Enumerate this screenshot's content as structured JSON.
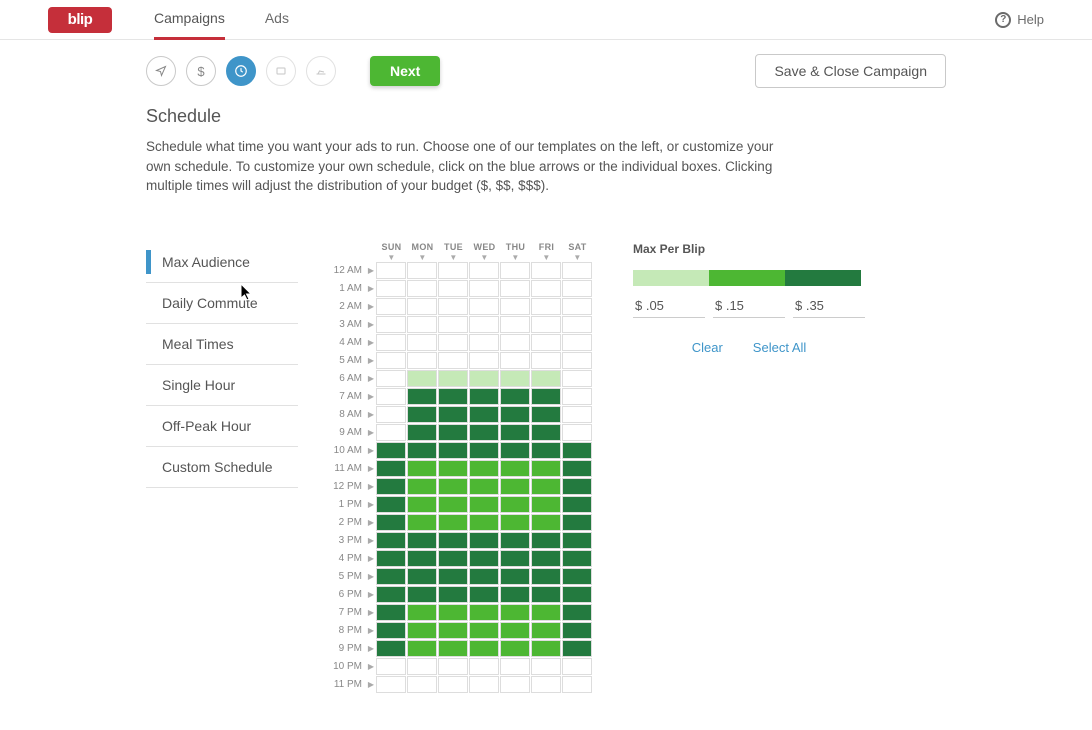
{
  "nav": {
    "brand": "blip",
    "tabs": [
      "Campaigns",
      "Ads"
    ],
    "active": 0,
    "help": "Help"
  },
  "stepper": {
    "next": "Next",
    "save": "Save & Close Campaign"
  },
  "header": {
    "title": "Schedule",
    "body": "Schedule what time you want your ads to run. Choose one of our templates on the left, or customize your own schedule. To customize your own schedule, click on the blue arrows or the individual boxes. Clicking multiple times will adjust the distribution of your budget ($, $$, $$$)."
  },
  "templates": {
    "items": [
      "Max Audience",
      "Daily Commute",
      "Meal Times",
      "Single Hour",
      "Off-Peak Hour",
      "Custom Schedule"
    ],
    "active": 0
  },
  "schedule": {
    "days": [
      "SUN",
      "MON",
      "TUE",
      "WED",
      "THU",
      "FRI",
      "SAT"
    ],
    "hours": [
      "12 AM",
      "1 AM",
      "2 AM",
      "3 AM",
      "4 AM",
      "5 AM",
      "6 AM",
      "7 AM",
      "8 AM",
      "9 AM",
      "10 AM",
      "11 AM",
      "12 PM",
      "1 PM",
      "2 PM",
      "3 PM",
      "4 PM",
      "5 PM",
      "6 PM",
      "7 PM",
      "8 PM",
      "9 PM",
      "10 PM",
      "11 PM"
    ],
    "grid": [
      [
        0,
        0,
        0,
        0,
        0,
        0,
        0
      ],
      [
        0,
        0,
        0,
        0,
        0,
        0,
        0
      ],
      [
        0,
        0,
        0,
        0,
        0,
        0,
        0
      ],
      [
        0,
        0,
        0,
        0,
        0,
        0,
        0
      ],
      [
        0,
        0,
        0,
        0,
        0,
        0,
        0
      ],
      [
        0,
        0,
        0,
        0,
        0,
        0,
        0
      ],
      [
        0,
        1,
        1,
        1,
        1,
        1,
        0
      ],
      [
        0,
        3,
        3,
        3,
        3,
        3,
        0
      ],
      [
        0,
        3,
        3,
        3,
        3,
        3,
        0
      ],
      [
        0,
        3,
        3,
        3,
        3,
        3,
        0
      ],
      [
        3,
        3,
        3,
        3,
        3,
        3,
        3
      ],
      [
        3,
        2,
        2,
        2,
        2,
        2,
        3
      ],
      [
        3,
        2,
        2,
        2,
        2,
        2,
        3
      ],
      [
        3,
        2,
        2,
        2,
        2,
        2,
        3
      ],
      [
        3,
        2,
        2,
        2,
        2,
        2,
        3
      ],
      [
        3,
        3,
        3,
        3,
        3,
        3,
        3
      ],
      [
        3,
        3,
        3,
        3,
        3,
        3,
        3
      ],
      [
        3,
        3,
        3,
        3,
        3,
        3,
        3
      ],
      [
        3,
        3,
        3,
        3,
        3,
        3,
        3
      ],
      [
        3,
        2,
        2,
        2,
        2,
        2,
        3
      ],
      [
        3,
        2,
        2,
        2,
        2,
        2,
        3
      ],
      [
        3,
        2,
        2,
        2,
        2,
        2,
        3
      ],
      [
        0,
        0,
        0,
        0,
        0,
        0,
        0
      ],
      [
        0,
        0,
        0,
        0,
        0,
        0,
        0
      ]
    ]
  },
  "maxPerBlip": {
    "title": "Max Per Blip",
    "prices": [
      "$ .05",
      "$ .15",
      "$ .35"
    ],
    "clear": "Clear",
    "selectAll": "Select All"
  }
}
